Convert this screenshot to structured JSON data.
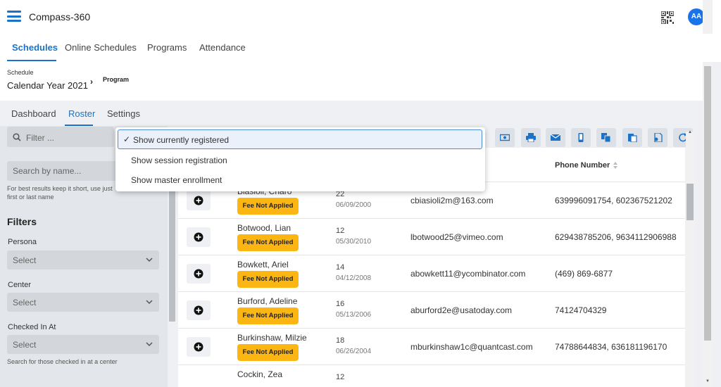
{
  "header": {
    "app_title": "Compass-360",
    "avatar_initials": "AA"
  },
  "main_tabs": [
    {
      "label": "Schedules",
      "active": true
    },
    {
      "label": "Online Schedules"
    },
    {
      "label": "Programs"
    },
    {
      "label": "Attendance"
    }
  ],
  "breadcrumb": {
    "schedule_label": "Schedule",
    "schedule_value": "Calendar Year 2021",
    "program_label": "Program"
  },
  "sub_tabs": [
    {
      "label": "Dashboard"
    },
    {
      "label": "Roster",
      "active": true
    },
    {
      "label": "Settings"
    }
  ],
  "left_panel": {
    "filter_placeholder": "Filter ...",
    "name_search_placeholder": "Search by name...",
    "hint": "For best results keep it short, use just first or last name",
    "filters_title": "Filters",
    "filters": [
      {
        "label": "Persona",
        "placeholder": "Select"
      },
      {
        "label": "Center",
        "placeholder": "Select"
      },
      {
        "label": "Checked In At",
        "placeholder": "Select"
      }
    ],
    "center_hint": "Search for those checked in at a center"
  },
  "dropdown": {
    "options": [
      {
        "label": "Show currently registered",
        "selected": true
      },
      {
        "label": "Show session registration"
      },
      {
        "label": "Show master enrollment"
      }
    ]
  },
  "toolbar": {
    "buttons": [
      "money-icon",
      "print-icon",
      "email-icon",
      "mobile-icon",
      "copy-icon",
      "clipboard-icon",
      "file-user-icon",
      "refresh-icon"
    ]
  },
  "table": {
    "phone_header": "Phone Number",
    "rows": [
      {
        "name": "Biasioli, Charo",
        "fee_status": "Fee Not Applied",
        "age": "22",
        "dob": "06/09/2000",
        "email": "cbiasioli2m@163.com",
        "phone": "639996091754, 602367521202"
      },
      {
        "name": "Botwood, Lian",
        "fee_status": "Fee Not Applied",
        "age": "12",
        "dob": "05/30/2010",
        "email": "lbotwood25@vimeo.com",
        "phone": "629438785206, 9634112906988"
      },
      {
        "name": "Bowkett, Ariel",
        "fee_status": "Fee Not Applied",
        "age": "14",
        "dob": "04/12/2008",
        "email": "abowkett11@ycombinator.com",
        "phone": "(469) 869-6877"
      },
      {
        "name": "Burford, Adeline",
        "fee_status": "Fee Not Applied",
        "age": "16",
        "dob": "05/13/2006",
        "email": "aburford2e@usatoday.com",
        "phone": "74124704329"
      },
      {
        "name": "Burkinshaw, Milzie",
        "fee_status": "Fee Not Applied",
        "age": "18",
        "dob": "06/26/2004",
        "email": "mburkinshaw1c@quantcast.com",
        "phone": "74788644834, 636181196170"
      },
      {
        "name": "Cockin, Zea",
        "fee_status": "",
        "age": "12",
        "dob": "",
        "email": "",
        "phone": ""
      }
    ]
  }
}
